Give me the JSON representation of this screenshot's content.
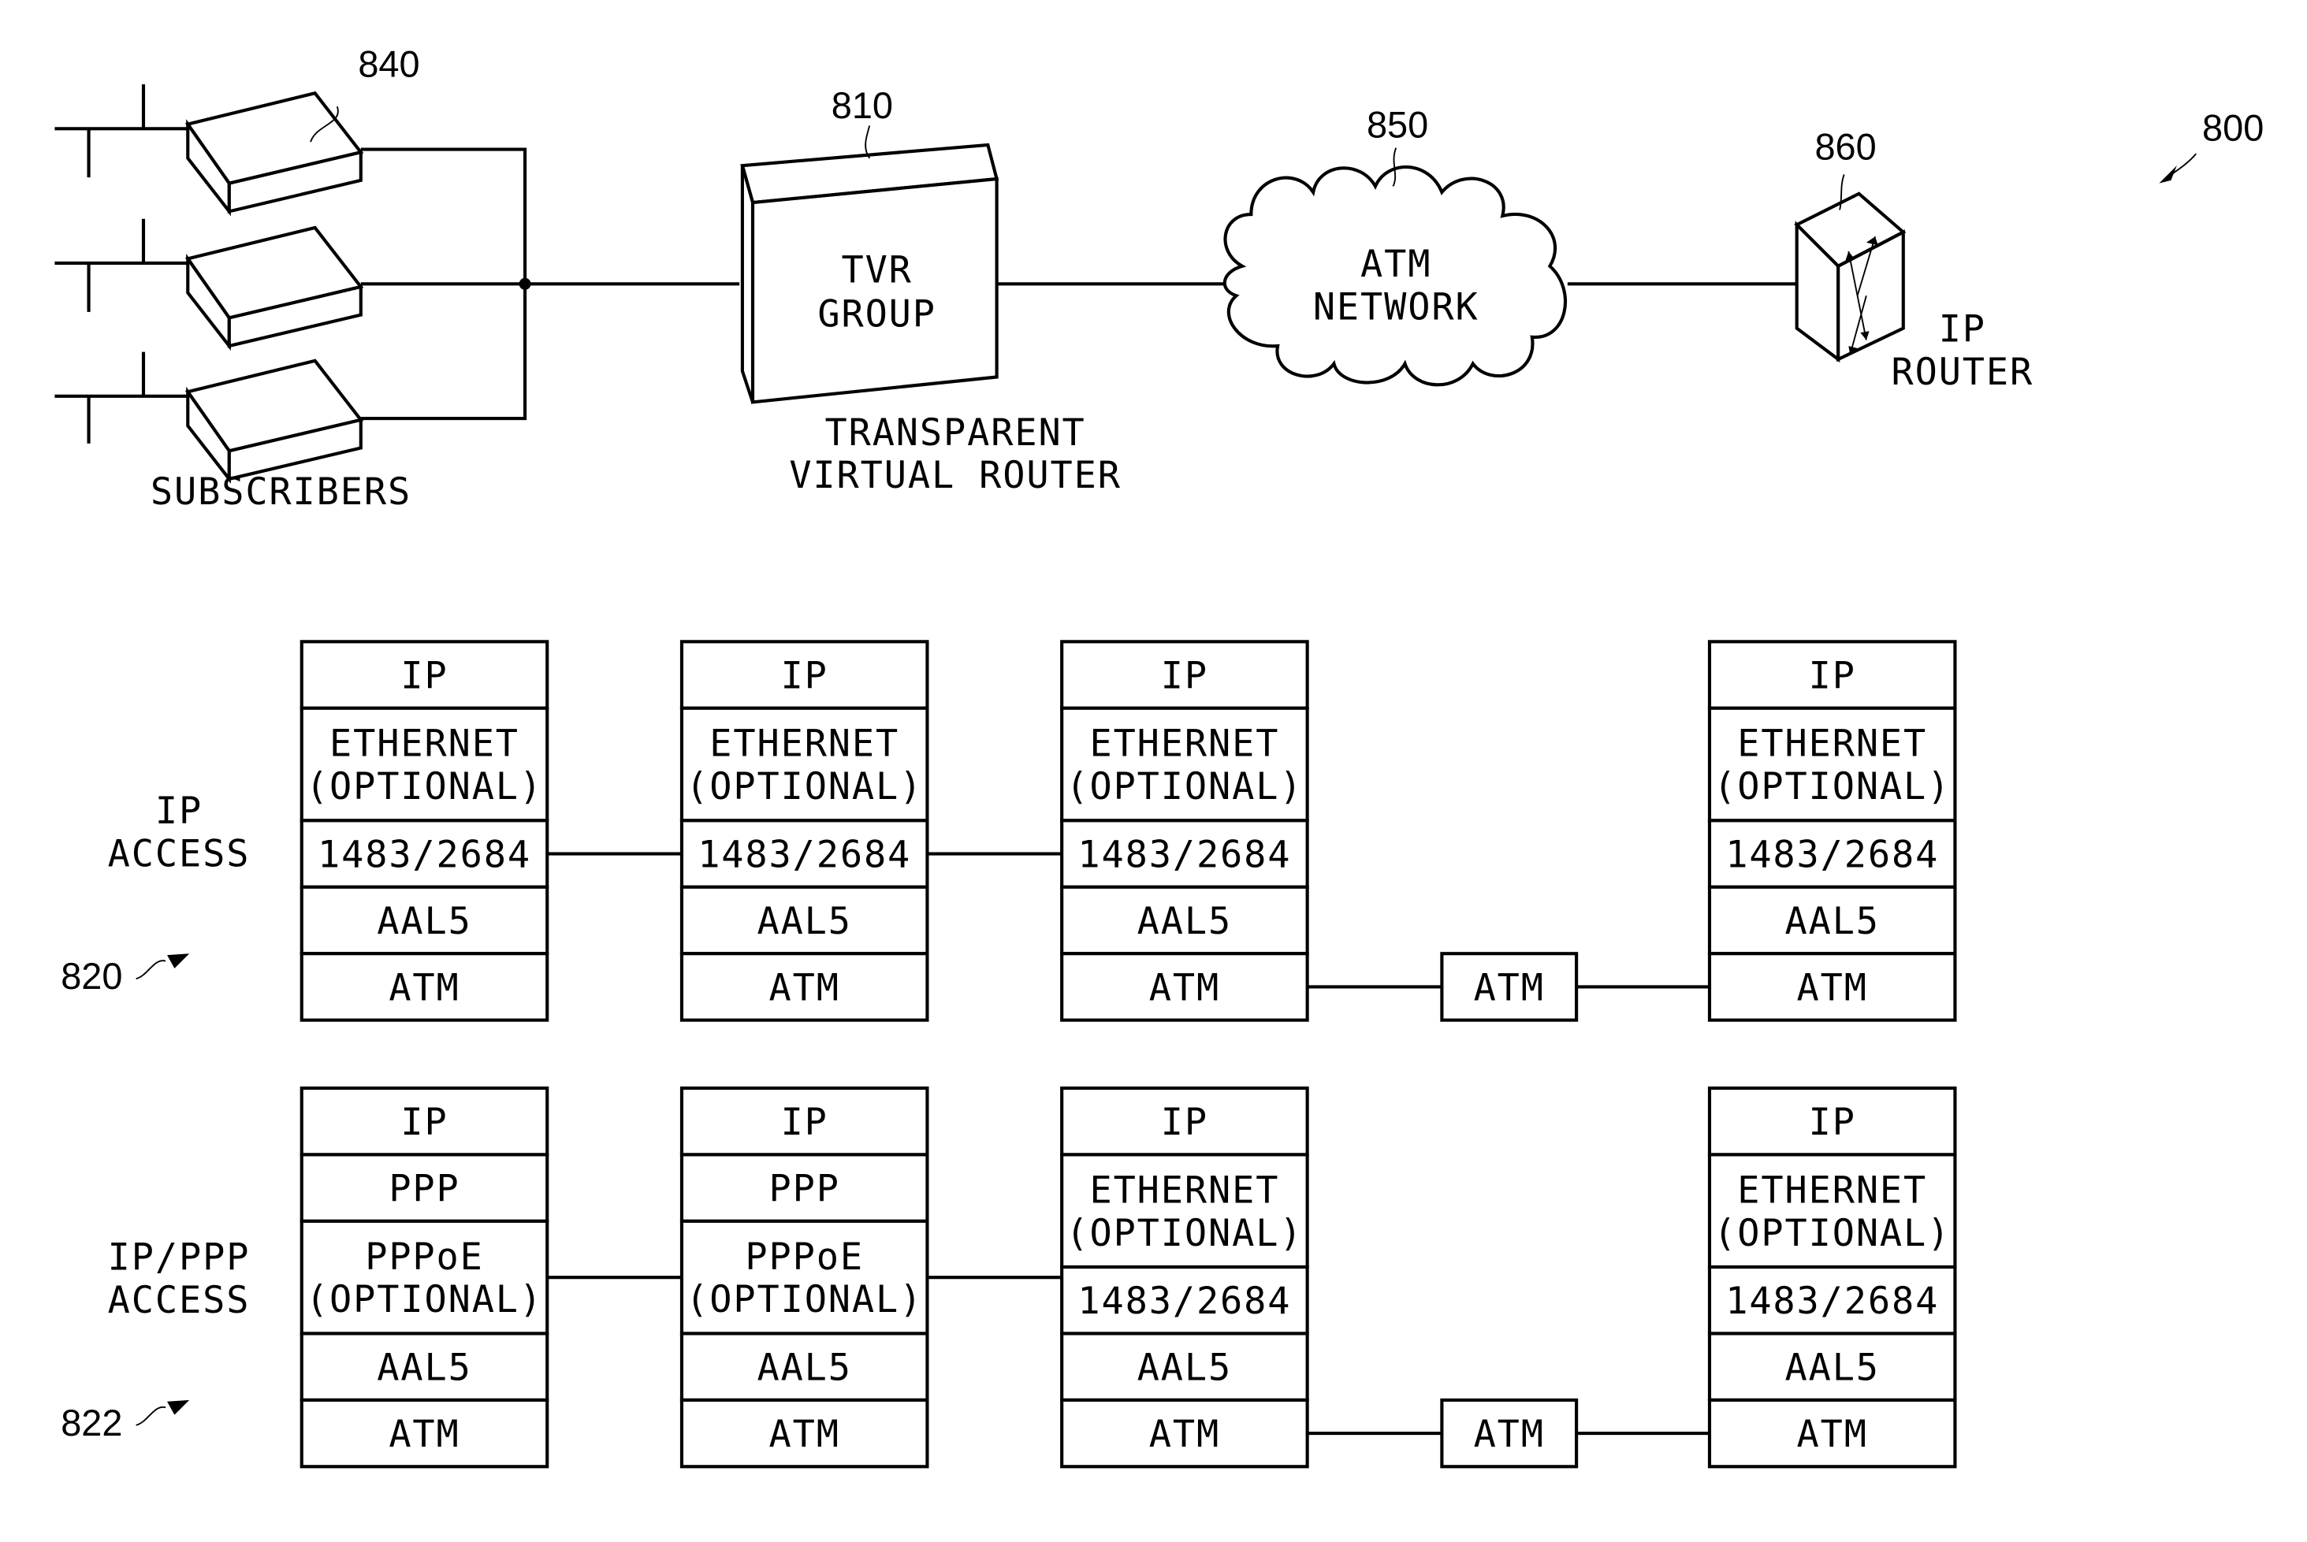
{
  "figure": {
    "reference": "800",
    "top": {
      "subscribers": {
        "ref": "840",
        "label": "SUBSCRIBERS",
        "count": 3
      },
      "tvr": {
        "ref": "810",
        "line1": "TVR",
        "line2": "GROUP",
        "caption1": "TRANSPARENT",
        "caption2": "VIRTUAL ROUTER"
      },
      "atm_network": {
        "ref": "850",
        "line1": "ATM",
        "line2": "NETWORK"
      },
      "ip_router": {
        "ref": "860",
        "line1": "IP",
        "line2": "ROUTER"
      }
    },
    "ip_access": {
      "ref": "820",
      "label1": "IP",
      "label2": "ACCESS",
      "stacks": [
        {
          "layers": [
            [
              "IP"
            ],
            [
              "ETHERNET",
              "(OPTIONAL)"
            ],
            [
              "1483/2684"
            ],
            [
              "AAL5"
            ],
            [
              "ATM"
            ]
          ]
        },
        {
          "layers": [
            [
              "IP"
            ],
            [
              "ETHERNET",
              "(OPTIONAL)"
            ],
            [
              "1483/2684"
            ],
            [
              "AAL5"
            ],
            [
              "ATM"
            ]
          ]
        },
        {
          "layers": [
            [
              "IP"
            ],
            [
              "ETHERNET",
              "(OPTIONAL)"
            ],
            [
              "1483/2684"
            ],
            [
              "AAL5"
            ],
            [
              "ATM"
            ]
          ]
        },
        {
          "layers": [
            [
              "IP"
            ],
            [
              "ETHERNET",
              "(OPTIONAL)"
            ],
            [
              "1483/2684"
            ],
            [
              "AAL5"
            ],
            [
              "ATM"
            ]
          ]
        }
      ],
      "switch_label": "ATM"
    },
    "ip_ppp_access": {
      "ref": "822",
      "label1": "IP/PPP",
      "label2": "ACCESS",
      "stacks": [
        {
          "layers": [
            [
              "IP"
            ],
            [
              "PPP"
            ],
            [
              "PPPoE",
              "(OPTIONAL)"
            ],
            [
              "AAL5"
            ],
            [
              "ATM"
            ]
          ]
        },
        {
          "layers": [
            [
              "IP"
            ],
            [
              "PPP"
            ],
            [
              "PPPoE",
              "(OPTIONAL)"
            ],
            [
              "AAL5"
            ],
            [
              "ATM"
            ]
          ]
        },
        {
          "layers": [
            [
              "IP"
            ],
            [
              "ETHERNET",
              "(OPTIONAL)"
            ],
            [
              "1483/2684"
            ],
            [
              "AAL5"
            ],
            [
              "ATM"
            ]
          ]
        },
        {
          "layers": [
            [
              "IP"
            ],
            [
              "ETHERNET",
              "(OPTIONAL)"
            ],
            [
              "1483/2684"
            ],
            [
              "AAL5"
            ],
            [
              "ATM"
            ]
          ]
        }
      ],
      "switch_label": "ATM"
    }
  }
}
